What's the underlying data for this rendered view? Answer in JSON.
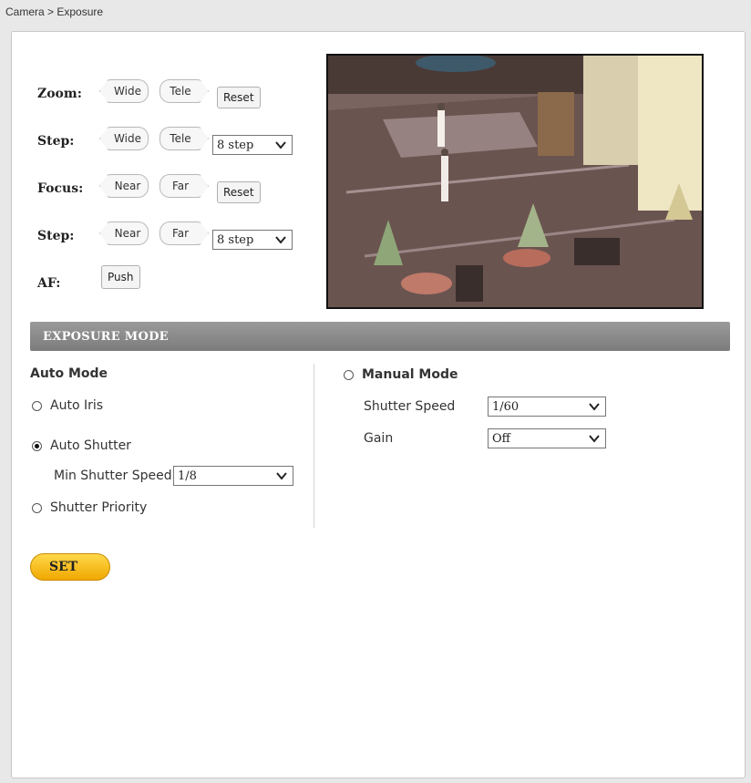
{
  "breadcrumb": "Camera > Exposure",
  "controls": {
    "zoom_label": "Zoom:",
    "zoom_step_label": "Step:",
    "focus_label": "Focus:",
    "focus_step_label": "Step:",
    "af_label": "AF:",
    "wide": "Wide",
    "tele": "Tele",
    "near": "Near",
    "far": "Far",
    "reset": "Reset",
    "push": "Push",
    "zoom_step_value": "8 step",
    "focus_step_value": "8 step"
  },
  "section_title": "EXPOSURE MODE",
  "auto": {
    "title": "Auto Mode",
    "auto_iris": "Auto Iris",
    "auto_shutter": "Auto Shutter",
    "min_shutter_label": "Min Shutter Speed",
    "min_shutter_value": "1/8",
    "shutter_priority": "Shutter Priority",
    "selected": "auto_shutter"
  },
  "manual": {
    "title": "Manual Mode",
    "shutter_label": "Shutter Speed",
    "shutter_value": "1/60",
    "gain_label": "Gain",
    "gain_value": "Off"
  },
  "set_button": "SET"
}
